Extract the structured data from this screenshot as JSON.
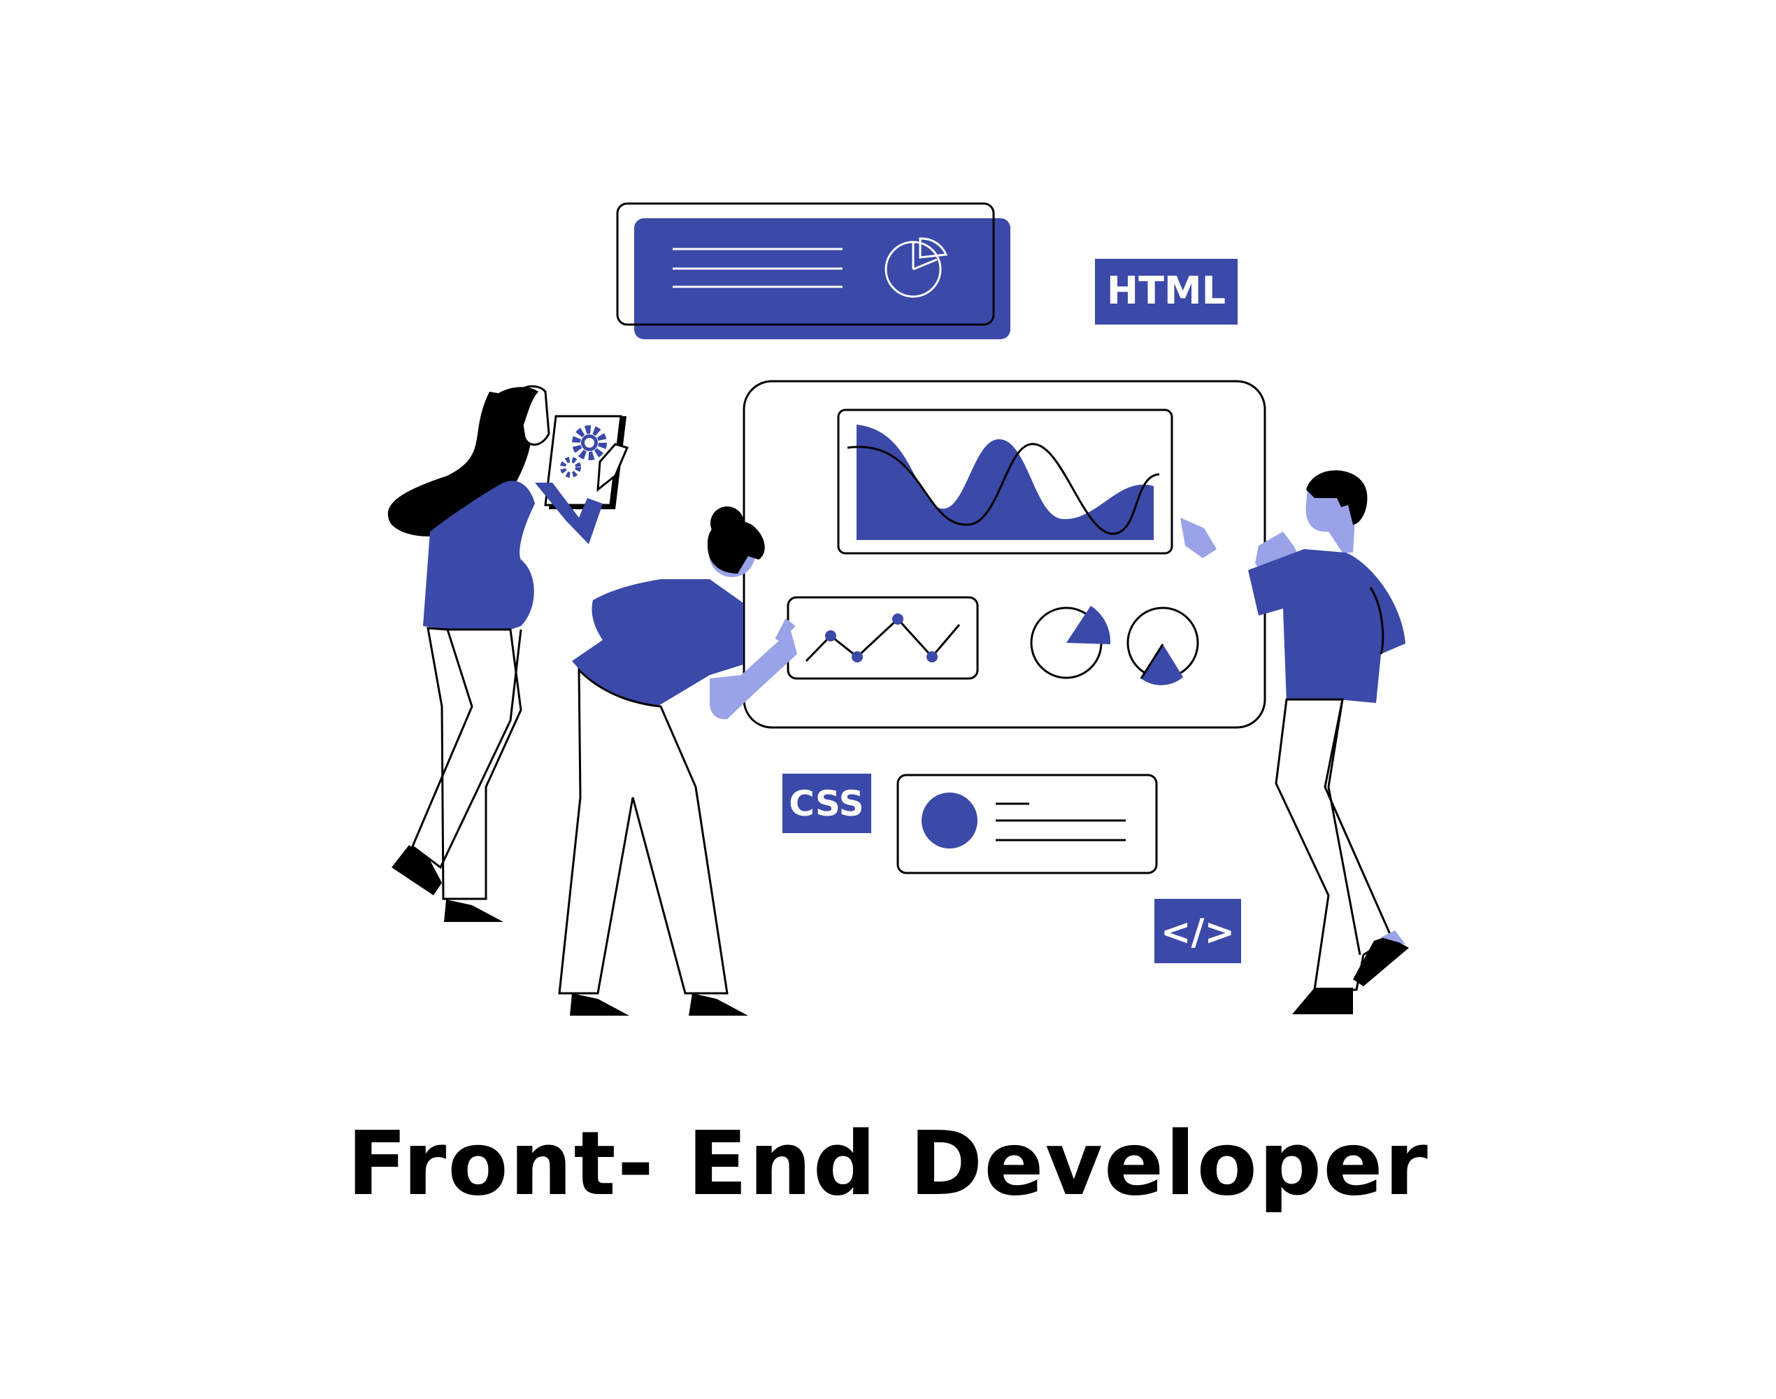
{
  "illustration": {
    "title": "Front- End Developer",
    "tags": {
      "html": "HTML",
      "css": "CSS",
      "code": "</>"
    },
    "icons": [
      "pie-chart-icon",
      "gear-icon",
      "code-icon"
    ]
  },
  "colors": {
    "primary": "#3b49a8",
    "light": "#9aa2e8",
    "ink": "#000000",
    "background": "#ffffff"
  }
}
